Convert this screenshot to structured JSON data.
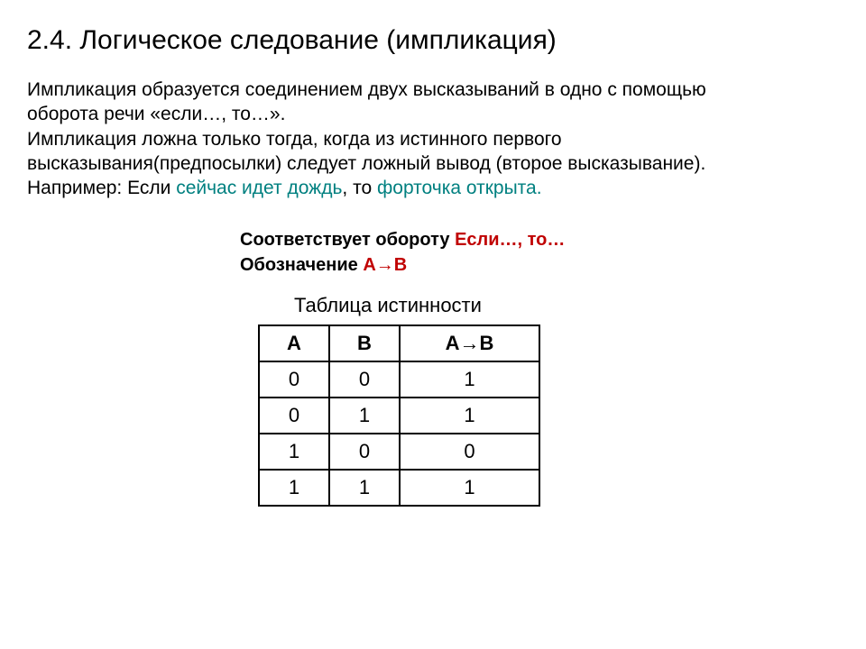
{
  "heading": "2.4. Логическое следование (импликация)",
  "body": {
    "line1": "Импликация образуется соединением двух высказываний в одно с помощью ",
    "line2": "оборота речи «если…, то…».",
    "line3": "Импликация ложна только тогда, когда из истинного первого ",
    "line4": "высказывания(предпосылки)  следует ложный вывод (второе высказывание).",
    "line5": "Например: Если",
    "line5_teal": " сейчас идет дождь",
    "line5_mid": ", то",
    "line5_teal2": " форточка открыта."
  },
  "notation": {
    "corresp_label": "Соответствует обороту  ",
    "corresp_red": "Если…, то…",
    "notation_label": "Обозначение ",
    "notation_red": "А→В"
  },
  "table_caption": "Таблица истинности",
  "chart_data": {
    "type": "table",
    "headers": [
      "A",
      "B",
      "A→B"
    ],
    "rows": [
      [
        "0",
        "0",
        "1"
      ],
      [
        "0",
        "1",
        "1"
      ],
      [
        "1",
        "0",
        "0"
      ],
      [
        "1",
        "1",
        "1"
      ]
    ]
  }
}
